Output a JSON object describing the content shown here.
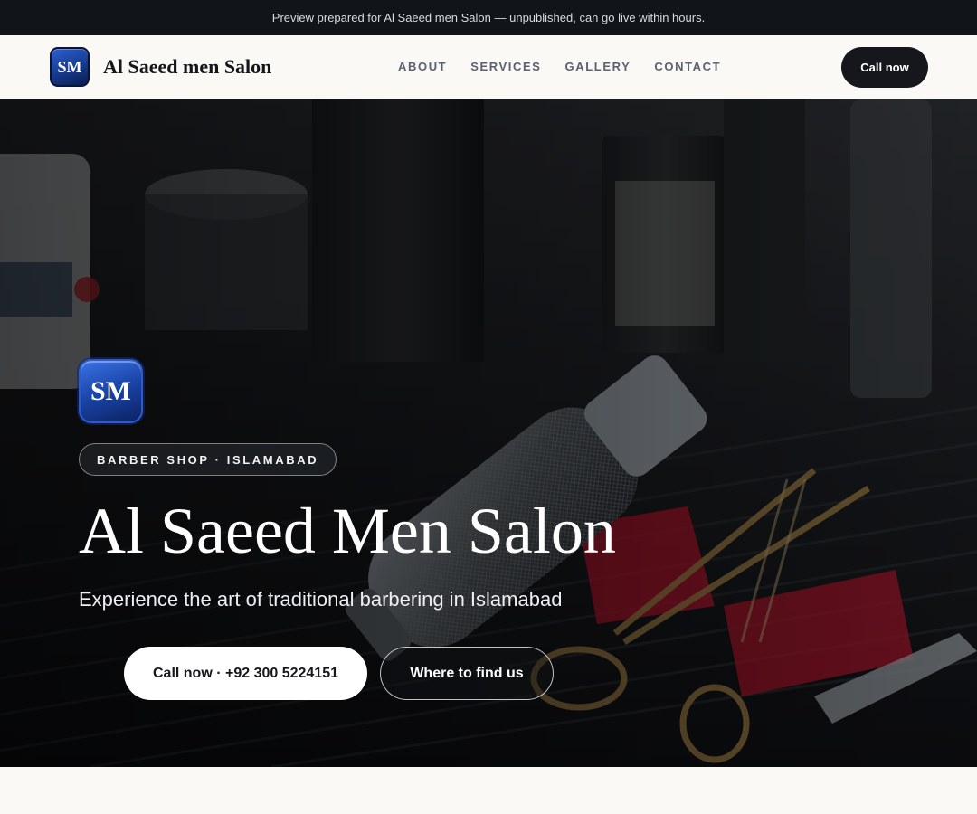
{
  "preview_bar": {
    "text": "Preview prepared for Al Saeed men Salon — unpublished, can go live within hours."
  },
  "header": {
    "logo_initials": "SM",
    "brand_name": "Al Saeed men Salon",
    "nav": [
      "ABOUT",
      "SERVICES",
      "GALLERY",
      "CONTACT"
    ],
    "call_label": "Call now"
  },
  "hero": {
    "logo_initials": "SM",
    "tag": "BARBER SHOP · ISLAMABAD",
    "title": "Al Saeed Men Salon",
    "subtitle": "Experience the art of traditional barbering in Islamabad",
    "primary_button": "Call now · +92 300 5224151",
    "secondary_button": "Where to find us",
    "background_image": "barber-tools-photo"
  },
  "colors": {
    "dark": "#15171c",
    "badge_blue": "#1a44a6",
    "page_bg": "#faf9f6"
  }
}
